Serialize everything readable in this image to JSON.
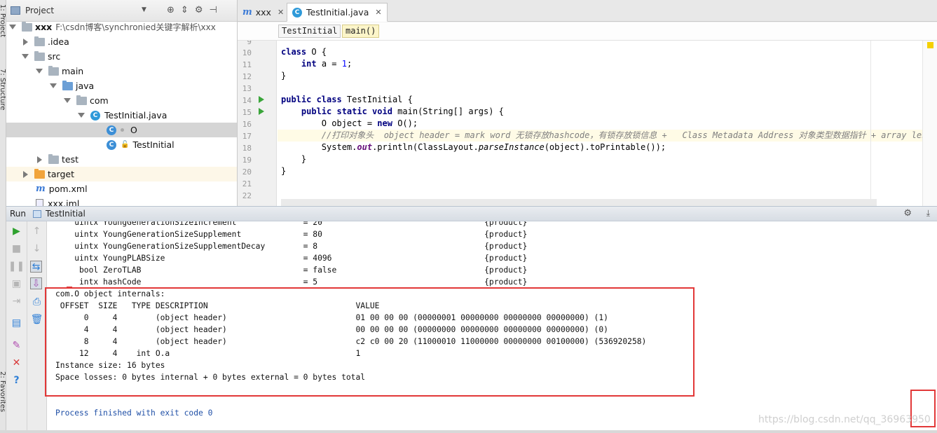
{
  "left_stripe": {
    "tab1": "1: Project",
    "tab2": "7: Structure",
    "tab3": "2: Favorites"
  },
  "project": {
    "title": "Project",
    "tree": [
      {
        "label": "xxx",
        "extra": "F:\\csdn博客\\synchronied关键字解析\\xxx"
      },
      {
        "label": ".idea"
      },
      {
        "label": "src"
      },
      {
        "label": "main"
      },
      {
        "label": "java"
      },
      {
        "label": "com"
      },
      {
        "label": "TestInitial.java"
      },
      {
        "label": "O"
      },
      {
        "label": "TestInitial"
      },
      {
        "label": "test"
      },
      {
        "label": "target"
      },
      {
        "label": "pom.xml"
      },
      {
        "label": "xxx.iml"
      }
    ]
  },
  "tabs": [
    {
      "label": "xxx"
    },
    {
      "label": "TestInitial.java"
    }
  ],
  "breadcrumbs": [
    "TestInitial",
    "main()"
  ],
  "editor": {
    "line_numbers": [
      "9",
      "10",
      "11",
      "12",
      "13",
      "14",
      "15",
      "16",
      "17",
      "18",
      "19",
      "20",
      "21",
      "22"
    ],
    "code": {
      "l10a": "class",
      "l10b": " O {",
      "l11a": "    ",
      "l11b": "int",
      "l11c": " a = ",
      "l11d": "1",
      "l11e": ";",
      "l12": "}",
      "l14a": "public class",
      "l14b": " TestInitial {",
      "l15a": "    ",
      "l15b": "public static void",
      "l15c": " main(String[] args) {",
      "l16a": "        O object = ",
      "l16b": "new",
      "l16c": " O();",
      "l17": "        //打印对象头  object header = mark word 无锁存放hashcode，有锁存放锁信息 +   Class Metadata Address 对象类型数据指针 + array length 数",
      "l18a": "        System.",
      "l18b": "out",
      "l18c": ".println(ClassLayout.",
      "l18d": "parseInstance",
      "l18e": "(object).toPrintable());",
      "l19": "    }",
      "l20": "}"
    }
  },
  "run": {
    "label": "Run",
    "config": "TestInitial"
  },
  "console": {
    "lines": [
      "    uintx YoungGenerationSizeIncrement              = 20                                  {product}",
      "    uintx YoungGenerationSizeSupplement             = 80                                  {product}",
      "    uintx YoungGenerationSizeSupplementDecay        = 8                                   {product}",
      "    uintx YoungPLABSize                             = 4096                                {product}",
      "     bool ZeroTLAB                                  = false                               {product}",
      "     intx hashCode                                  = 5                                   {product}",
      "com.O object internals:",
      " OFFSET  SIZE   TYPE DESCRIPTION                               VALUE",
      "      0     4        (object header)                           01 00 00 00 (00000001 00000000 00000000 00000000) (1)",
      "      4     4        (object header)                           00 00 00 00 (00000000 00000000 00000000 00000000) (0)",
      "      8     4        (object header)                           c2 c0 00 20 (11000010 11000000 00000000 00100000) (536920258)",
      "     12     4    int O.a                                       1",
      "Instance size: 16 bytes",
      "Space losses: 0 bytes internal + 0 bytes external = 0 bytes total",
      "",
      "Process finished with exit code 0"
    ]
  },
  "watermark": "https://blog.csdn.net/qq_36963950"
}
